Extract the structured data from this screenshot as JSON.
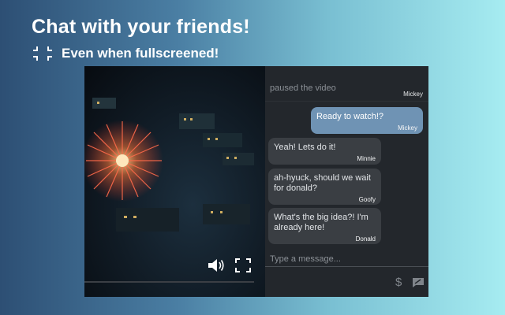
{
  "header": {
    "title": "Chat with your friends!",
    "subtitle": "Even when fullscreened!",
    "subtitle_icon": "exit-fullscreen-icon"
  },
  "video": {
    "volume_icon": "volume-icon",
    "fullscreen_icon": "fullscreen-icon",
    "progress": 0
  },
  "chat": {
    "system_message": {
      "text": "paused the video",
      "author": "Mickey"
    },
    "messages": [
      {
        "text": "Ready to watch!?",
        "author": "Mickey",
        "self": true
      },
      {
        "text": "Yeah! Lets do it!",
        "author": "Minnie",
        "self": false
      },
      {
        "text": "ah-hyuck, should we wait for donald?",
        "author": "Goofy",
        "self": false
      },
      {
        "text": "What's the big idea?! I'm already here!",
        "author": "Donald",
        "self": false
      }
    ],
    "input_placeholder": "Type a message...",
    "icons": [
      "dollar-icon",
      "send-message-icon"
    ]
  },
  "colors": {
    "self_bubble": "#6f93b4",
    "other_bubble": "#3a3e43",
    "chat_background": "#23272c"
  }
}
